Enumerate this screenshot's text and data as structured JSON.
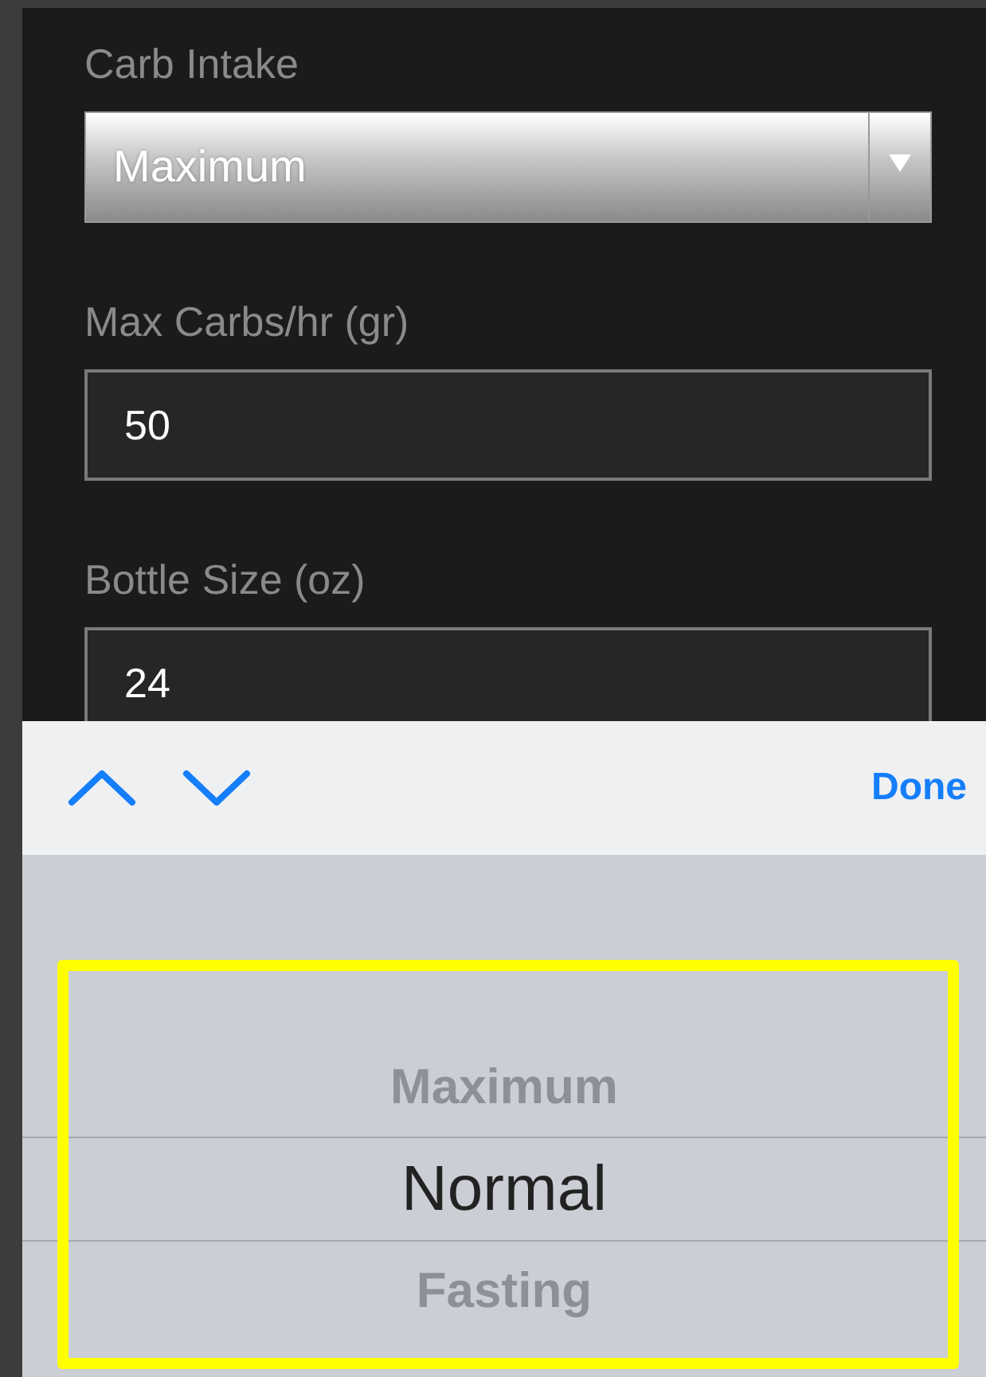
{
  "form": {
    "fields": [
      {
        "kind": "select",
        "label": "Carb Intake",
        "value": "Maximum"
      },
      {
        "kind": "input",
        "label": "Max Carbs/hr (gr)",
        "value": "50"
      },
      {
        "kind": "input",
        "label": "Bottle Size (oz)",
        "value": "24"
      }
    ]
  },
  "keyboard_toolbar": {
    "done": "Done"
  },
  "picker": {
    "highlighted": true,
    "items": [
      {
        "label": "Maximum",
        "selected": false
      },
      {
        "label": "Normal",
        "selected": true
      },
      {
        "label": "Fasting",
        "selected": false
      }
    ]
  }
}
